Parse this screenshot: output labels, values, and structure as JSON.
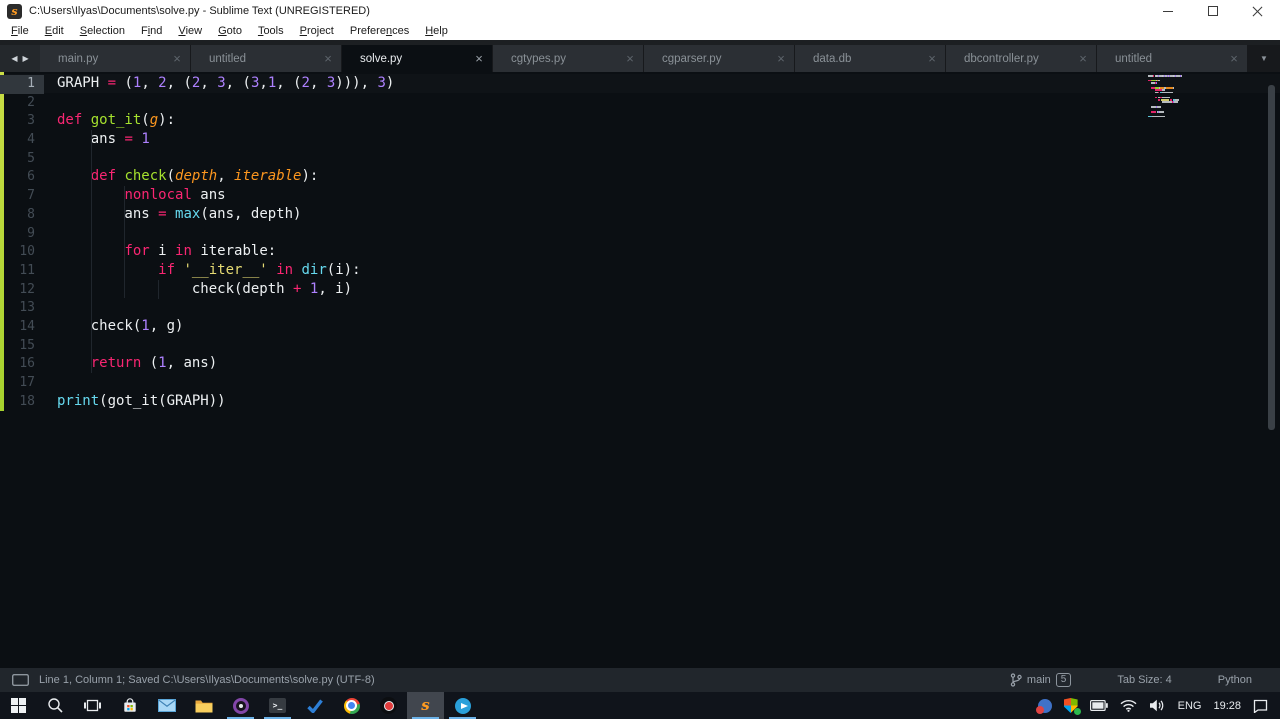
{
  "window": {
    "title": "C:\\Users\\Ilyas\\Documents\\solve.py - Sublime Text (UNREGISTERED)",
    "controls": [
      "minimize",
      "restore",
      "close"
    ]
  },
  "menu": {
    "items": [
      {
        "label": "File",
        "mnemonic": 0
      },
      {
        "label": "Edit",
        "mnemonic": 0
      },
      {
        "label": "Selection",
        "mnemonic": 0
      },
      {
        "label": "Find",
        "mnemonic": 1
      },
      {
        "label": "View",
        "mnemonic": 0
      },
      {
        "label": "Goto",
        "mnemonic": 0
      },
      {
        "label": "Tools",
        "mnemonic": 0
      },
      {
        "label": "Project",
        "mnemonic": 0
      },
      {
        "label": "Preferences",
        "mnemonic": 7
      },
      {
        "label": "Help",
        "mnemonic": 0
      }
    ]
  },
  "tabs": {
    "items": [
      {
        "label": "main.py",
        "active": false
      },
      {
        "label": "untitled",
        "active": false
      },
      {
        "label": "solve.py",
        "active": true
      },
      {
        "label": "cgtypes.py",
        "active": false
      },
      {
        "label": "cgparser.py",
        "active": false
      },
      {
        "label": "data.db",
        "active": false
      },
      {
        "label": "dbcontroller.py",
        "active": false
      },
      {
        "label": "untitled",
        "active": false
      }
    ]
  },
  "editor": {
    "current_line": 1,
    "lines": [
      [
        [
          "t",
          "GRAPH "
        ],
        [
          "k",
          "="
        ],
        [
          "t",
          " ("
        ],
        [
          "n",
          "1"
        ],
        [
          "t",
          ", "
        ],
        [
          "n",
          "2"
        ],
        [
          "t",
          ", ("
        ],
        [
          "n",
          "2"
        ],
        [
          "t",
          ", "
        ],
        [
          "n",
          "3"
        ],
        [
          "t",
          ", ("
        ],
        [
          "n",
          "3"
        ],
        [
          "t",
          ","
        ],
        [
          "n",
          "1"
        ],
        [
          "t",
          ", ("
        ],
        [
          "n",
          "2"
        ],
        [
          "t",
          ", "
        ],
        [
          "n",
          "3"
        ],
        [
          "t",
          "))), "
        ],
        [
          "n",
          "3"
        ],
        [
          "t",
          ")"
        ]
      ],
      [],
      [
        [
          "k",
          "def "
        ],
        [
          "f",
          "got_it"
        ],
        [
          "t",
          "("
        ],
        [
          "p",
          "g"
        ],
        [
          "t",
          "):"
        ]
      ],
      [
        [
          "t",
          "    ans "
        ],
        [
          "k",
          "="
        ],
        [
          "t",
          " "
        ],
        [
          "n",
          "1"
        ]
      ],
      [],
      [
        [
          "t",
          "    "
        ],
        [
          "k",
          "def "
        ],
        [
          "f",
          "check"
        ],
        [
          "t",
          "("
        ],
        [
          "p",
          "depth"
        ],
        [
          "t",
          ", "
        ],
        [
          "p",
          "iterable"
        ],
        [
          "t",
          "):"
        ]
      ],
      [
        [
          "t",
          "        "
        ],
        [
          "k",
          "nonlocal"
        ],
        [
          "t",
          " ans"
        ]
      ],
      [
        [
          "t",
          "        ans "
        ],
        [
          "k",
          "="
        ],
        [
          "t",
          " "
        ],
        [
          "b",
          "max"
        ],
        [
          "t",
          "(ans, depth)"
        ]
      ],
      [],
      [
        [
          "t",
          "        "
        ],
        [
          "k",
          "for"
        ],
        [
          "t",
          " i "
        ],
        [
          "k",
          "in"
        ],
        [
          "t",
          " iterable:"
        ]
      ],
      [
        [
          "t",
          "            "
        ],
        [
          "k",
          "if"
        ],
        [
          "t",
          " "
        ],
        [
          "s",
          "'__iter__'"
        ],
        [
          "t",
          " "
        ],
        [
          "k",
          "in"
        ],
        [
          "t",
          " "
        ],
        [
          "b",
          "dir"
        ],
        [
          "t",
          "(i):"
        ]
      ],
      [
        [
          "t",
          "                check(depth "
        ],
        [
          "k",
          "+"
        ],
        [
          "t",
          " "
        ],
        [
          "n",
          "1"
        ],
        [
          "t",
          ", i)"
        ]
      ],
      [],
      [
        [
          "t",
          "    check("
        ],
        [
          "n",
          "1"
        ],
        [
          "t",
          ", g)"
        ]
      ],
      [],
      [
        [
          "t",
          "    "
        ],
        [
          "k",
          "return"
        ],
        [
          "t",
          " ("
        ],
        [
          "n",
          "1"
        ],
        [
          "t",
          ", ans)"
        ]
      ],
      [],
      [
        [
          "b",
          "print"
        ],
        [
          "t",
          "(got_it(GRAPH))"
        ]
      ]
    ]
  },
  "status": {
    "left_text": "Line 1, Column 1; Saved C:\\Users\\Ilyas\\Documents\\solve.py (UTF-8)",
    "branch": "main",
    "branch_count": "5",
    "tab_size": "Tab Size: 4",
    "syntax": "Python"
  },
  "taskbar": {
    "icons": [
      {
        "name": "start-button"
      },
      {
        "name": "search-icon"
      },
      {
        "name": "task-view-icon"
      },
      {
        "name": "microsoft-store-icon"
      },
      {
        "name": "mail-icon"
      },
      {
        "name": "file-explorer-icon"
      },
      {
        "name": "purple-ring-app-icon",
        "running": true
      },
      {
        "name": "terminal-icon",
        "running": true
      },
      {
        "name": "todo-check-icon"
      },
      {
        "name": "chrome-icon"
      },
      {
        "name": "screen-recorder-icon"
      },
      {
        "name": "sublime-text-icon",
        "running": true,
        "active": true
      },
      {
        "name": "telegram-icon",
        "running": true
      }
    ],
    "tray": {
      "icons": [
        {
          "name": "tray-app-icon"
        },
        {
          "name": "windows-security-icon"
        },
        {
          "name": "battery-icon"
        },
        {
          "name": "wifi-icon"
        },
        {
          "name": "volume-icon"
        }
      ],
      "lang": "ENG",
      "time": "19:28",
      "right_icon": {
        "name": "action-center-icon"
      }
    }
  },
  "colors": {
    "tokens": {
      "t": "#c9ced3",
      "k": "#f92672",
      "f": "#a6e22e",
      "p": "#fd971f",
      "b": "#66d9ef",
      "n": "#ae81ff",
      "s": "#e6db74"
    },
    "added_gutter": "#b2d63a",
    "running_indicator": "#6cb2e8",
    "editor_bg": "#0b0f13",
    "accent_orange": "#ff9b21"
  }
}
